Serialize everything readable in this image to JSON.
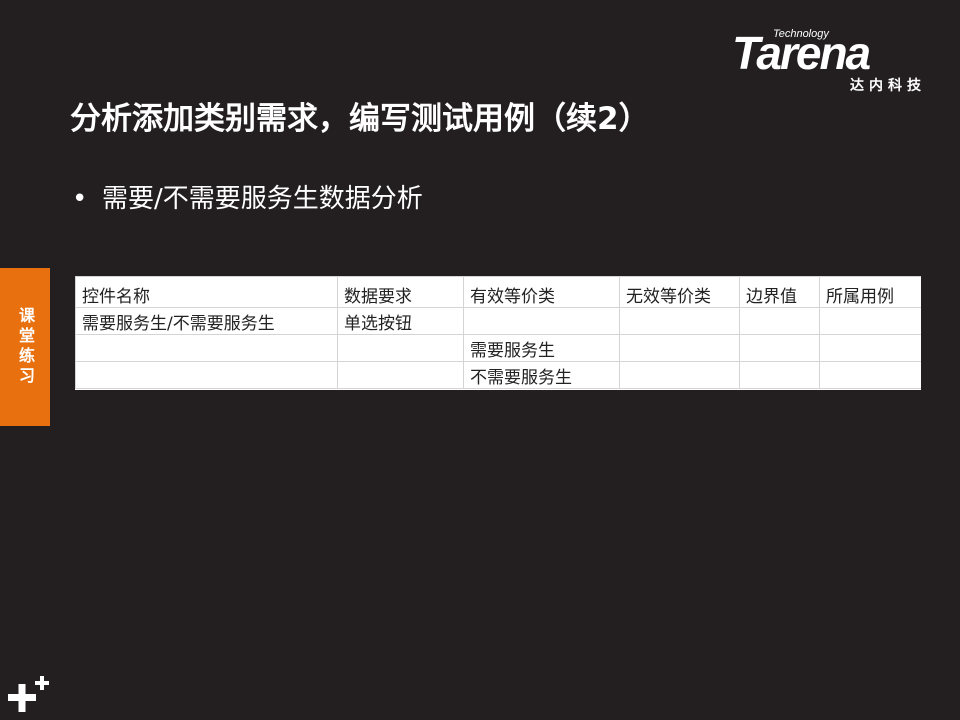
{
  "logo": {
    "tech": "Technology",
    "word": "Tarena",
    "cn": "达内科技"
  },
  "title": "分析添加类别需求，编写测试用例（续2）",
  "bullet": {
    "symbol": "•",
    "text": "需要/不需要服务生数据分析"
  },
  "side_tab": {
    "text": "课堂练习",
    "color": "#e8700f"
  },
  "table": {
    "headers": [
      "控件名称",
      "数据要求",
      "有效等价类",
      "无效等价类",
      "边界值",
      "所属用例"
    ],
    "rows": [
      [
        "需要服务生/不需要服务生",
        "单选按钮",
        "",
        "",
        "",
        ""
      ],
      [
        "",
        "",
        "需要服务生",
        "",
        "",
        ""
      ],
      [
        "",
        "",
        "不需要服务生",
        "",
        "",
        ""
      ]
    ]
  },
  "colors": {
    "background": "#231f20",
    "accent": "#e8700f"
  },
  "icons": {
    "corner": "plus-plus-icon"
  }
}
